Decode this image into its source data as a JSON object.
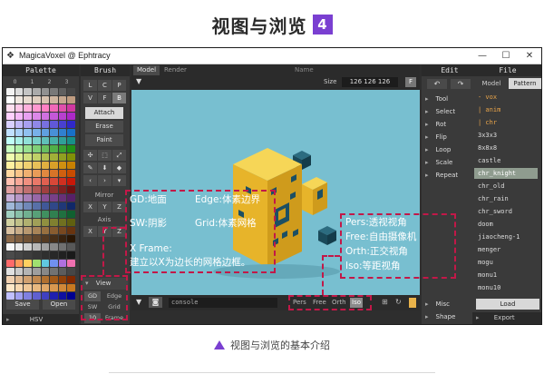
{
  "heading": {
    "title": "视图与浏览",
    "badge": "4"
  },
  "window": {
    "title": "MagicaVoxel @ Ephtracy",
    "controls": {
      "minimize": "—",
      "maximize": "☐",
      "close": "✕"
    }
  },
  "palette": {
    "header": "Palette",
    "page_numbers": [
      "0",
      "1",
      "2",
      "3"
    ],
    "save_label": "Save",
    "open_label": "Open",
    "hsv_label": "HSV",
    "colors": [
      "#f3f3f3",
      "#dcdcdc",
      "#c4c4c4",
      "#aaaaaa",
      "#919191",
      "#787878",
      "#5f5f5f",
      "#464646",
      "#ffffff",
      "#f0e8e0",
      "#e8dcd0",
      "#e0cfc0",
      "#d8c3b0",
      "#cfb6a0",
      "#c7a990",
      "#bf9c80",
      "#ffe0f0",
      "#ffc8e8",
      "#ffb0dc",
      "#ff98d0",
      "#ff80c4",
      "#f068b8",
      "#e050ac",
      "#d038a0",
      "#ffd0ff",
      "#f4b8f8",
      "#e8a0f0",
      "#dc88e8",
      "#d070e0",
      "#c458d8",
      "#b840d0",
      "#ac28c8",
      "#d8d0ff",
      "#c0b8f8",
      "#a8a0f0",
      "#9088e8",
      "#7870e0",
      "#6058d8",
      "#4840d0",
      "#3028c8",
      "#c0e0ff",
      "#a8d0f8",
      "#90c0f0",
      "#78b0e8",
      "#60a0e0",
      "#4890d8",
      "#3080d0",
      "#1870c8",
      "#c0fff8",
      "#a8f0e8",
      "#90e0d8",
      "#78d0c8",
      "#60c0b8",
      "#48b0a8",
      "#30a098",
      "#189088",
      "#c8ffc0",
      "#b0f0a8",
      "#98e090",
      "#80d078",
      "#68c060",
      "#50b048",
      "#38a030",
      "#209018",
      "#f0ffb0",
      "#e0f098",
      "#d0e080",
      "#c0d068",
      "#b0c050",
      "#a0b038",
      "#90a020",
      "#809008",
      "#fff0a0",
      "#f8e088",
      "#f0d070",
      "#e8c058",
      "#e0b040",
      "#d8a028",
      "#d09010",
      "#c88000",
      "#ffd8a0",
      "#f8c488",
      "#f0b070",
      "#e89c58",
      "#e08840",
      "#d87428",
      "#d06010",
      "#c84c00",
      "#ffc0b0",
      "#f8a898",
      "#f09080",
      "#e87868",
      "#e06050",
      "#d84838",
      "#d03020",
      "#c81808",
      "#e0a0a0",
      "#d08888",
      "#c07070",
      "#b05858",
      "#a04040",
      "#903030",
      "#802020",
      "#701010",
      "#c8b0d8",
      "#b898c8",
      "#a880b8",
      "#9868a8",
      "#885098",
      "#784088",
      "#683078",
      "#582068",
      "#a0b8d8",
      "#88a0c8",
      "#7088b8",
      "#5870a8",
      "#405898",
      "#304888",
      "#203878",
      "#102868",
      "#a0d0c0",
      "#88c0a8",
      "#70b090",
      "#58a078",
      "#409060",
      "#308050",
      "#207040",
      "#106030",
      "#d0d0a0",
      "#c0c088",
      "#b0b070",
      "#a0a058",
      "#909040",
      "#808030",
      "#707020",
      "#606010",
      "#d8c0a0",
      "#c8ac88",
      "#b89870",
      "#a88458",
      "#987040",
      "#885c30",
      "#784820",
      "#683410",
      "#8c6a4a",
      "#7e5e40",
      "#705236",
      "#62462c",
      "#543a22",
      "#462e18",
      "#38220e",
      "#2a1604",
      "#f8f8f8",
      "#e8e8e8",
      "#d0d0d0",
      "#b8b8b8",
      "#a0a0a0",
      "#888888",
      "#707070",
      "#585858",
      "#4b4b4b",
      "#444444",
      "#3d3d3d",
      "#363636",
      "#2f2f2f",
      "#282828",
      "#212121",
      "#1a1a1a",
      "#ff6a6a",
      "#ff9a5a",
      "#ffd060",
      "#a0e070",
      "#60c8e0",
      "#7090f0",
      "#b070e0",
      "#f070b0",
      "#e0e0e0",
      "#cacaca",
      "#b4b4b4",
      "#9e9e9e",
      "#888888",
      "#727272",
      "#5c5c5c",
      "#464646",
      "#f0d0b0",
      "#e0b890",
      "#d0a070",
      "#c08850",
      "#b07030",
      "#a05818",
      "#904008",
      "#802800",
      "#ffe8c8",
      "#f8d8b0",
      "#f0c898",
      "#e8b880",
      "#e0a868",
      "#d89850",
      "#d08838",
      "#c87820",
      "#c0c0ff",
      "#a0a0f0",
      "#8080e0",
      "#6060d0",
      "#4040c0",
      "#2020b0",
      "#1010a0",
      "#000090"
    ]
  },
  "brush": {
    "header": "Brush",
    "types": [
      "L",
      "C",
      "P",
      "V",
      "F",
      "B"
    ],
    "modes": [
      "Attach",
      "Erase",
      "Paint"
    ],
    "mirror_label": "Mirror",
    "mirror_axes": [
      "X",
      "Y",
      "Z"
    ],
    "axis_label": "Axis",
    "axis_axes": [
      "X",
      "Y",
      "Z"
    ]
  },
  "view_panel": {
    "label": "View",
    "rows": [
      {
        "key": "GD",
        "value": "Edge"
      },
      {
        "key": "SW",
        "value": "Grid"
      },
      {
        "key": "10",
        "value": "Frame"
      }
    ]
  },
  "viewport": {
    "tabs": [
      "Model",
      "Render"
    ],
    "name_placeholder": "Name",
    "size_label": "Size",
    "size_value": "126 126 126",
    "f_button": "F",
    "console_placeholder": "console",
    "cameras": [
      "Pers",
      "Free",
      "Orth",
      "Iso"
    ]
  },
  "edit": {
    "header": "Edit",
    "undo": "↶",
    "redo": "↷",
    "tools": [
      "Tool",
      "Select",
      "Rot",
      "Flip",
      "Loop",
      "Scale",
      "Repeat"
    ],
    "bottom": [
      "Misc",
      "Shape"
    ]
  },
  "file": {
    "header": "File",
    "tabs": [
      "Model",
      "Pattern"
    ],
    "items": [
      "- vox",
      "| anim",
      "| chr",
      "3x3x3",
      "8x8x8",
      "castle",
      "chr_knight",
      "chr_old",
      "chr_rain",
      "chr_sword",
      "doom",
      "jiaocheng-1",
      "menger",
      "mogu",
      "monu1",
      "monu10"
    ],
    "selected": "chr_knight",
    "load_label": "Load",
    "export_label": "Export"
  },
  "annotations": {
    "left_lines": [
      "GD:地面",
      "SW:阴影",
      "X Frame:",
      "建立以X为边长的网格边框。"
    ],
    "right_top": [
      "Edge:体素边界",
      "Grid:体素网格"
    ],
    "camera_lines": [
      "Pers:透视视角",
      "Free:自由摄像机",
      "Orth:正交视角",
      "Iso:等距视角"
    ]
  },
  "caption": "视图与浏览的基本介绍",
  "colors": {
    "accent": "#7a3fd1",
    "annotation_border": "#c21848",
    "viewport_bg": "#78bfd0",
    "voxel_yellow": "#f3c02a",
    "voxel_dark": "#1c4f63"
  }
}
